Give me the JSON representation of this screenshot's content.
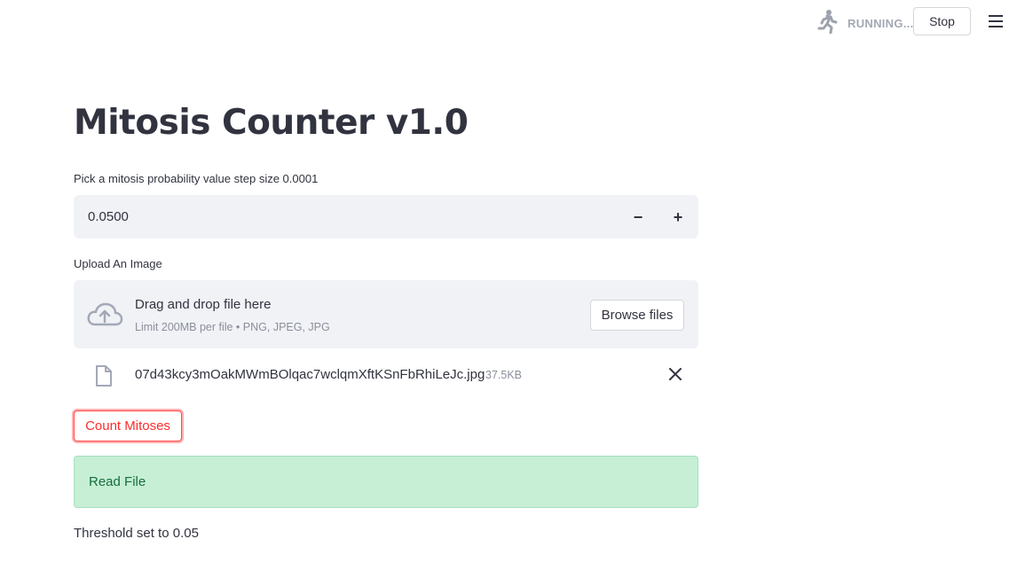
{
  "header": {
    "status_text": "RUNNING...",
    "stop_label": "Stop",
    "running_icon": "running-man-icon",
    "menu_icon": "hamburger-menu-icon"
  },
  "main": {
    "title": "Mitosis Counter v1.0",
    "number_input": {
      "label": "Pick a mitosis probability value step size 0.0001",
      "value": "0.0500",
      "decrement_label": "−",
      "increment_label": "+"
    },
    "uploader": {
      "label": "Upload An Image",
      "drop_title": "Drag and drop file here",
      "limit_text": "Limit 200MB per file • PNG, JPEG, JPG",
      "browse_label": "Browse files",
      "icon": "cloud-upload-icon"
    },
    "uploaded_file": {
      "name": "07d43kcy3mOakMWmBOlqac7wclqmXftKSnFbRhiLeJc.jpg",
      "size": "37.5KB",
      "icon": "file-icon",
      "remove_icon": "close-icon"
    },
    "count_button_label": "Count Mitoses",
    "success_message": "Read File",
    "threshold_text": "Threshold set to 0.05"
  },
  "colors": {
    "accent": "#ff4b4b",
    "input_background": "#f0f2f6",
    "success_background": "#c6efd5",
    "success_text": "#176e3c",
    "text": "#31333f",
    "muted_text": "#8b8f9a"
  }
}
